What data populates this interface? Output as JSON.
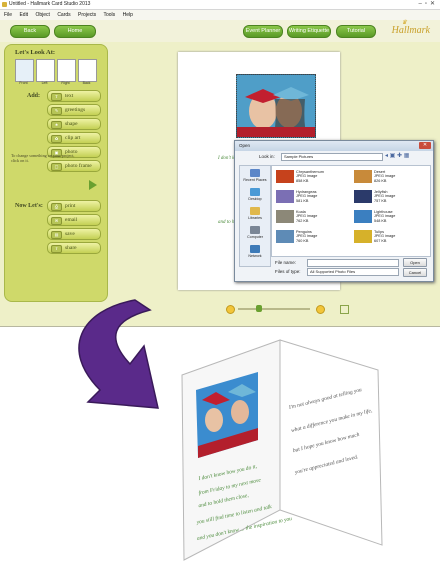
{
  "window": {
    "title": "Untitled - Hallmark Card Studio 2013"
  },
  "menu": [
    "File",
    "Edit",
    "Object",
    "Cards",
    "Projects",
    "Tools",
    "Help"
  ],
  "toolbar": {
    "back": "Back",
    "home": "Home",
    "event_planner": "Event Planner",
    "writing_etiquette": "Writing Etiquette",
    "tutorial": "Tutorial",
    "logo": "Hallmark"
  },
  "left_panel": {
    "header": "Let's Look At:",
    "views": [
      "Front",
      "Left",
      "Right",
      "Back"
    ],
    "add_label": "Add:",
    "add_items": [
      "text",
      "greetings",
      "shape",
      "clip art",
      "photo",
      "photo frame"
    ],
    "hint": "To change something on your project, click on it.",
    "now_label": "Now Let's:",
    "now_items": [
      "print",
      "email",
      "save",
      "share"
    ]
  },
  "open_dialog": {
    "title": "Open",
    "look_in_label": "Look in:",
    "look_in_value": "Sample Pictures",
    "places": [
      "Recent Places",
      "Desktop",
      "Libraries",
      "Computer",
      "Network"
    ],
    "files": [
      {
        "name": "Chrysanthemum",
        "type": "JPEG image",
        "size": "858 KB",
        "color": "#c6421c"
      },
      {
        "name": "Desert",
        "type": "JPEG image",
        "size": "826 KB",
        "color": "#c88a3a"
      },
      {
        "name": "Hydrangeas",
        "type": "JPEG image",
        "size": "581 KB",
        "color": "#7b6fb4"
      },
      {
        "name": "Jellyfish",
        "type": "JPEG image",
        "size": "757 KB",
        "color": "#2b3a6a"
      },
      {
        "name": "Koala",
        "type": "JPEG image",
        "size": "762 KB",
        "color": "#8c8878"
      },
      {
        "name": "Lighthouse",
        "type": "JPEG image",
        "size": "548 KB",
        "color": "#3b7fc0"
      },
      {
        "name": "Penguins",
        "type": "JPEG image",
        "size": "760 KB",
        "color": "#5e8bb6"
      },
      {
        "name": "Tulips",
        "type": "JPEG image",
        "size": "607 KB",
        "color": "#d6b12a"
      }
    ],
    "file_name_label": "File name:",
    "file_type_label": "Files of type:",
    "file_type_value": "All Supported Photo Files",
    "open_button": "Open",
    "cancel_button": "Cancel"
  },
  "card": {
    "left_text": [
      "I don't know how you do it,",
      "from Friday to my next move",
      "and to hold them close,",
      "you still find time to listen and talk",
      "and you don't know ... the inspiration to you"
    ],
    "right_text": [
      "I'm not always good at telling you",
      "what a difference you make in my life,",
      "but I hope you know how much",
      "you're appreciated and loved."
    ]
  }
}
